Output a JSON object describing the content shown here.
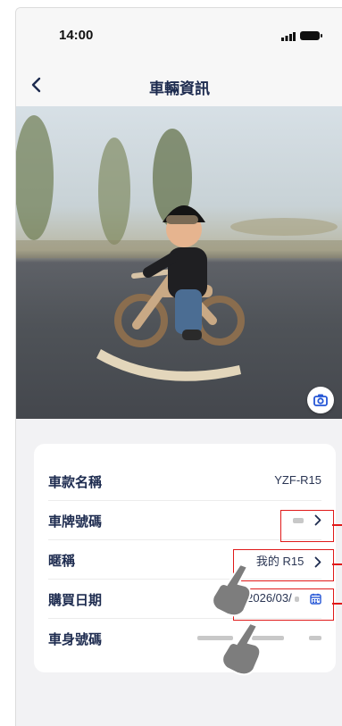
{
  "status": {
    "time": "14:00"
  },
  "header": {
    "title": "車輛資訊"
  },
  "vehicle": {
    "rows": [
      {
        "label": "車款名稱",
        "value": "YZF-R15"
      },
      {
        "label": "車牌號碼",
        "value": ""
      },
      {
        "label": "暱稱",
        "value": "我的 R15"
      },
      {
        "label": "購買日期",
        "value": "2026/03/"
      },
      {
        "label": "車身號碼",
        "value": ""
      }
    ]
  },
  "colors": {
    "accent": "#1d2b4f",
    "highlight": "#e01a1a",
    "link": "#2456d6"
  },
  "icons": [
    "back-chevron-icon",
    "camera-icon",
    "chevron-right-icon",
    "calendar-icon",
    "signal-icon",
    "battery-icon",
    "pointing-hand-icon"
  ]
}
